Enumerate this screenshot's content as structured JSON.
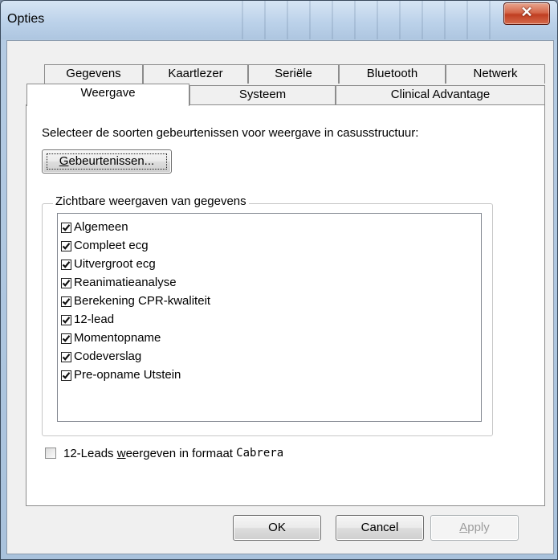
{
  "window": {
    "title": "Opties"
  },
  "titlebar": {
    "close_glyph": "✕"
  },
  "tabs_row1": [
    "Gegevens",
    "Kaartlezer",
    "Seriële",
    "Bluetooth",
    "Netwerk"
  ],
  "tabs_row2": [
    "Weergave",
    "Systeem",
    "Clinical Advantage"
  ],
  "active_tab": "Weergave",
  "panel": {
    "prompt": "Selecteer de soorten gebeurtenissen voor weergave in casusstructuur:",
    "events_button": {
      "mnemonic": "G",
      "rest": "ebeurtenissen..."
    },
    "group_label": "Zichtbare weergaven van gegevens",
    "items": [
      {
        "label": "Algemeen",
        "checked": true
      },
      {
        "label": "Compleet ecg",
        "checked": true
      },
      {
        "label": "Uitvergroot ecg",
        "checked": true
      },
      {
        "label": "Reanimatieanalyse",
        "checked": true
      },
      {
        "label": "Berekening CPR-kwaliteit",
        "checked": true
      },
      {
        "label": "12-lead",
        "checked": true
      },
      {
        "label": "Momentopname",
        "checked": true
      },
      {
        "label": "Codeverslag",
        "checked": true
      },
      {
        "label": "Pre-opname Utstein",
        "checked": true
      }
    ],
    "cabrera": {
      "checked": false,
      "pre": "12-Leads ",
      "mnemonic": "w",
      "mid": "eergeven in formaat ",
      "mono": "Cabrera"
    }
  },
  "buttons": {
    "ok": "OK",
    "cancel": "Cancel",
    "apply_mnemonic": "A",
    "apply_rest": "pply"
  }
}
